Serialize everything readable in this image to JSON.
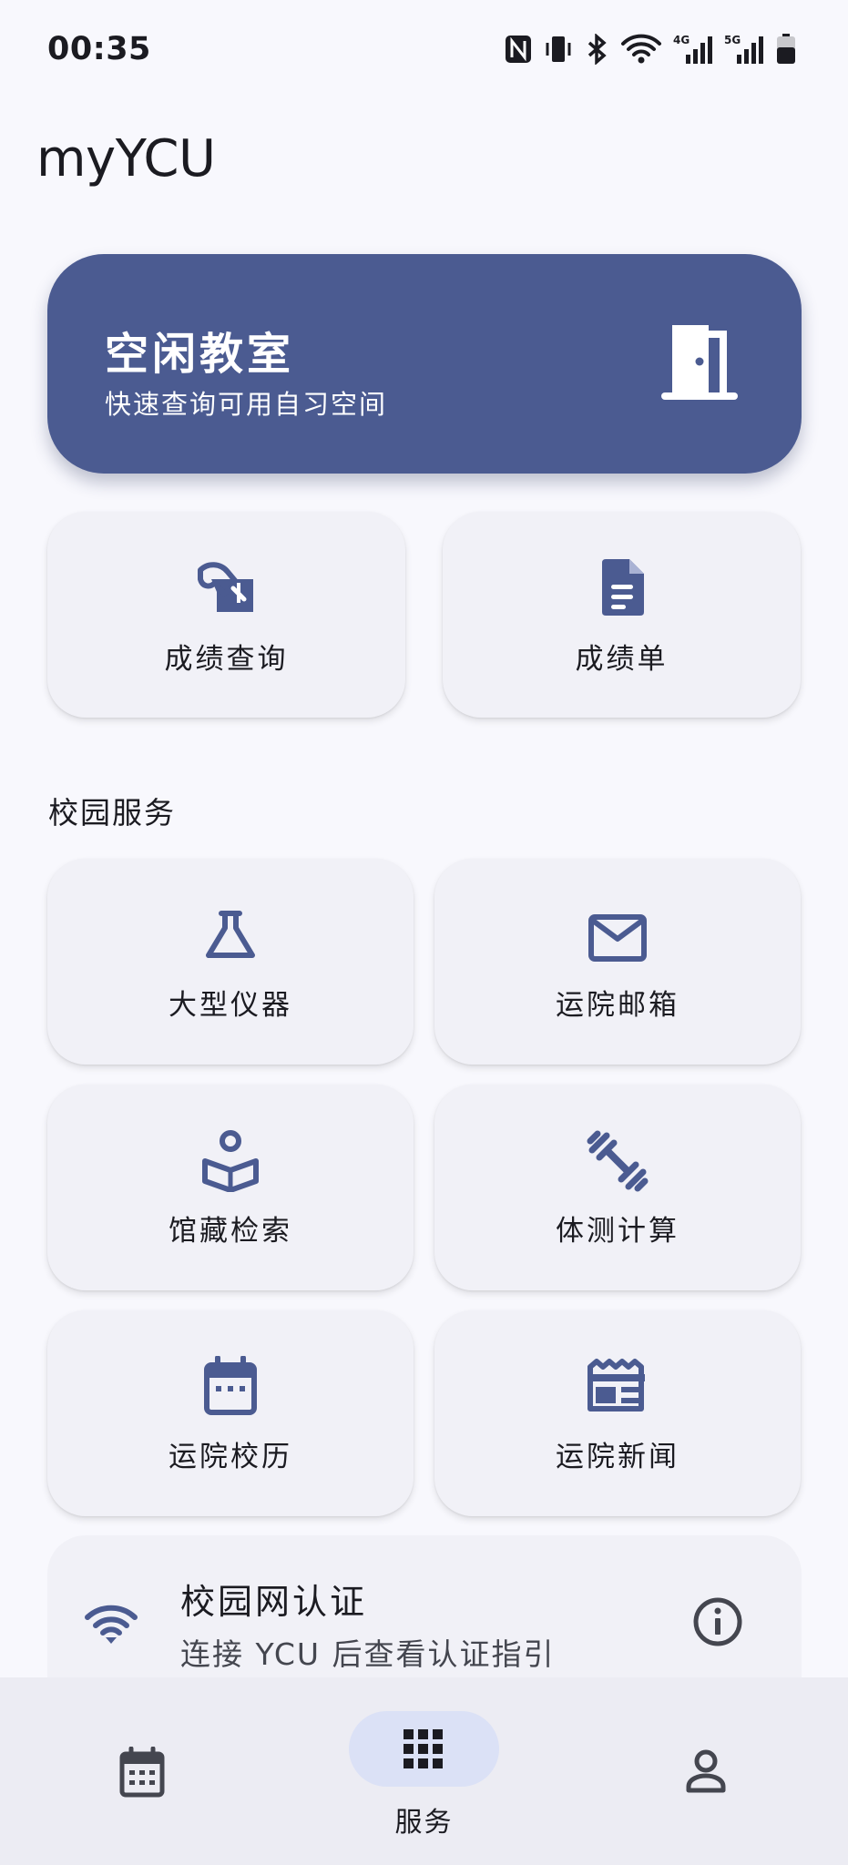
{
  "status": {
    "time": "00:35"
  },
  "app": {
    "title": "myYCU"
  },
  "hero": {
    "title": "空闲教室",
    "subtitle": "快速查询可用自习空间",
    "icon": "door-open-icon"
  },
  "quick": [
    {
      "label": "成绩查询",
      "icon": "grade-search-icon"
    },
    {
      "label": "成绩单",
      "icon": "document-icon"
    }
  ],
  "campus": {
    "title": "校园服务",
    "items": [
      {
        "label": "大型仪器",
        "icon": "flask-icon"
      },
      {
        "label": "运院邮箱",
        "icon": "mail-icon"
      },
      {
        "label": "馆藏检索",
        "icon": "library-icon"
      },
      {
        "label": "体测计算",
        "icon": "fitness-icon"
      },
      {
        "label": "运院校历",
        "icon": "calendar-icon"
      },
      {
        "label": "运院新闻",
        "icon": "news-icon"
      }
    ]
  },
  "network": {
    "title": "校园网认证",
    "subtitle": "连接 YCU 后查看认证指引",
    "icon": "wifi-icon",
    "info_icon": "info-icon"
  },
  "nav": {
    "items": [
      {
        "icon": "calendar-icon"
      },
      {
        "label": "服务",
        "icon": "apps-grid-icon"
      },
      {
        "icon": "person-icon"
      }
    ]
  },
  "colors": {
    "accent": "#4b5b91",
    "background": "#f8f8fd",
    "card": "#f1f1f7",
    "nav_pill": "#dbe1f6"
  }
}
